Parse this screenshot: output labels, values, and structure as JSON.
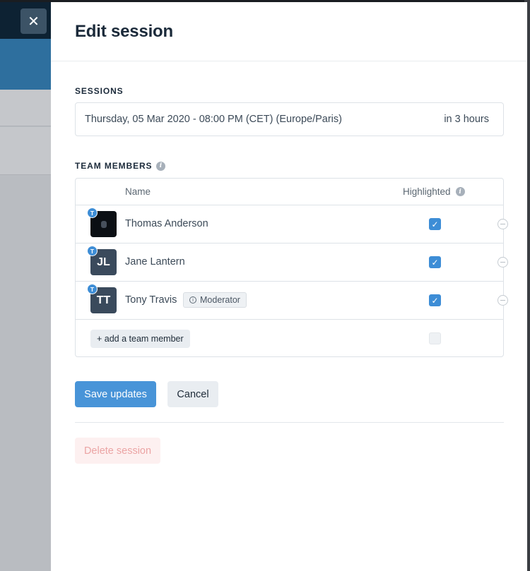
{
  "colors": {
    "accent": "#4894d8",
    "title": "#1b2a3a",
    "danger_soft": "#eba4a4"
  },
  "close_button": {
    "icon": "close-icon",
    "glyph": "✕"
  },
  "panel": {
    "title": "Edit session"
  },
  "sessions": {
    "label": "SESSIONS",
    "date": "Thursday, 05 Mar 2020 - 08:00 PM (CET) (Europe/Paris)",
    "relative": "in 3 hours"
  },
  "team": {
    "label": "TEAM MEMBERS",
    "columns": {
      "name": "Name",
      "highlighted": "Highlighted"
    },
    "members": [
      {
        "name": "Thomas Anderson",
        "initials": "",
        "role_badge": "T",
        "highlighted": true,
        "avatar": "photo"
      },
      {
        "name": "Jane Lantern",
        "initials": "JL",
        "role_badge": "T",
        "highlighted": true
      },
      {
        "name": "Tony Travis",
        "initials": "TT",
        "role_badge": "T",
        "highlighted": true,
        "tag": "Moderator"
      }
    ],
    "add_label": "+ add a team member"
  },
  "actions": {
    "save": "Save updates",
    "cancel": "Cancel",
    "delete": "Delete session"
  }
}
